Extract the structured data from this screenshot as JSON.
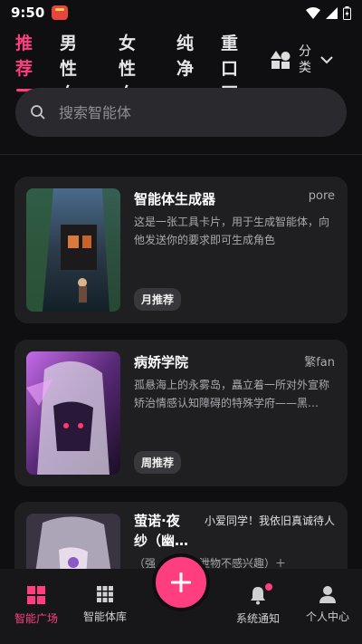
{
  "status_bar": {
    "time": "9:50"
  },
  "tabs": [
    {
      "label": "推荐",
      "active": true
    },
    {
      "label": "男性向",
      "active": false
    },
    {
      "label": "女性向",
      "active": false
    },
    {
      "label": "纯净",
      "active": false
    },
    {
      "label": "重口区",
      "active": false
    }
  ],
  "category_button": {
    "label": "分类"
  },
  "search": {
    "placeholder": "搜索智能体"
  },
  "cards": [
    {
      "title": "智能体生成器",
      "author": "pore",
      "description": "这是一张工具卡片，用于生成智能体，向他发送你的要求即可生成角色",
      "badge": "月推荐"
    },
    {
      "title": "病娇学院",
      "author": "繁fan",
      "description": "孤悬海上的永雾岛，矗立着一所对外宣称矫治情感认知障碍的特殊学府——黑…",
      "badge": "周推荐"
    },
    {
      "title": "萤诺·夜纱（幽…",
      "author": "小爱同学！我依旧真诚待人",
      "description": "（强…（对排泄物不感兴趣）＋",
      "badge": ""
    }
  ],
  "bottom_nav": [
    {
      "label": "智能广场",
      "icon": "grid-icon",
      "active": true
    },
    {
      "label": "智能体库",
      "icon": "apps-icon",
      "active": false
    },
    {
      "label": "系统通知",
      "icon": "bell-icon",
      "active": false
    },
    {
      "label": "个人中心",
      "icon": "person-icon",
      "active": false
    }
  ],
  "fab": {
    "label": "+"
  },
  "colors": {
    "accent": "#ff3e80",
    "background": "#0f0f11",
    "card": "#1f1f22"
  }
}
